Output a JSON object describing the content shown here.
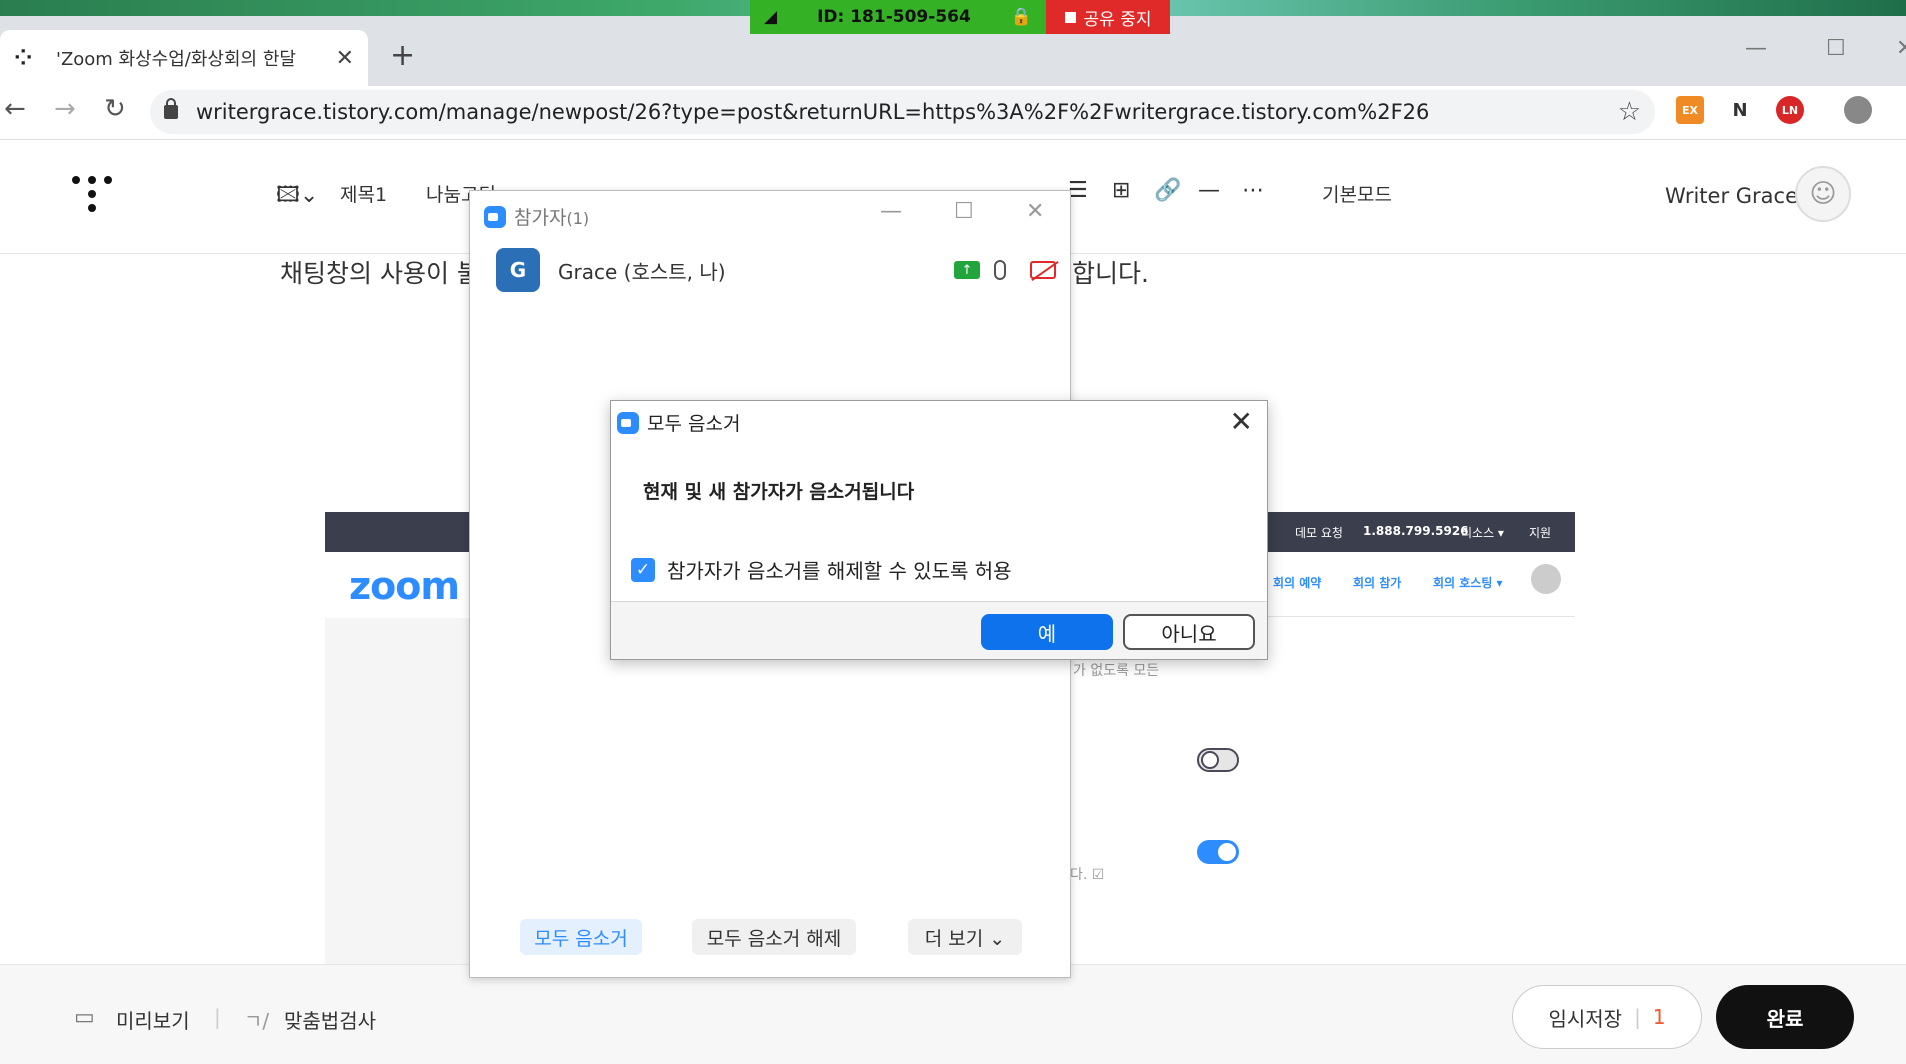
{
  "share_bar": {
    "meeting_id": "ID: 181-509-564",
    "stop_label": "공유 중지",
    "color_green": "#35b126",
    "color_red": "#e02a2a"
  },
  "browser": {
    "tab_title": "'Zoom 화상수업/화상회의 한달",
    "url": "writergrace.tistory.com/manage/newpost/26?type=post&returnURL=https%3A%2F%2Fwritergrace.tistory.com%2F26",
    "extensions": [
      "EX",
      "N",
      "LN"
    ]
  },
  "editor": {
    "toolbar": {
      "heading": "제목1",
      "font": "나눔고딕",
      "mode": "기본모드"
    },
    "writer_name": "Writer Grace"
  },
  "content": {
    "paragraph_left": "채팅창의 사용이 불",
    "paragraph_right": "합니다.",
    "zoom_screenshot": {
      "logo": "zoom",
      "top_links": [
        "데모 요청",
        "1.888.799.5926",
        "리소스 ▾",
        "지원"
      ],
      "nav_links": [
        "회의 예약",
        "회의 참가",
        "회의 호스팅 ▾"
      ],
      "snippet_1": "가 없도록 모든",
      "snippet_2": "다. ☑"
    }
  },
  "participants_window": {
    "title": "참가자",
    "count": "(1)",
    "participant": {
      "initial": "G",
      "name": "Grace (호스트, 나)"
    },
    "buttons": {
      "mute_all": "모두 음소거",
      "unmute_all": "모두 음소거 해제",
      "more": "더 보기 ⌄"
    }
  },
  "mute_dialog": {
    "title": "모두 음소거",
    "message": "현재 및 새 참가자가 음소거됩니다",
    "checkbox_label": "참가자가 음소거를 해제할 수 있도록 허용",
    "checkbox_checked": true,
    "yes_label": "예",
    "no_label": "아니요"
  },
  "bottom_bar": {
    "preview": "미리보기",
    "spellcheck": "맞춤법검사",
    "draft": "임시저장",
    "draft_count": "1",
    "done": "완료"
  }
}
